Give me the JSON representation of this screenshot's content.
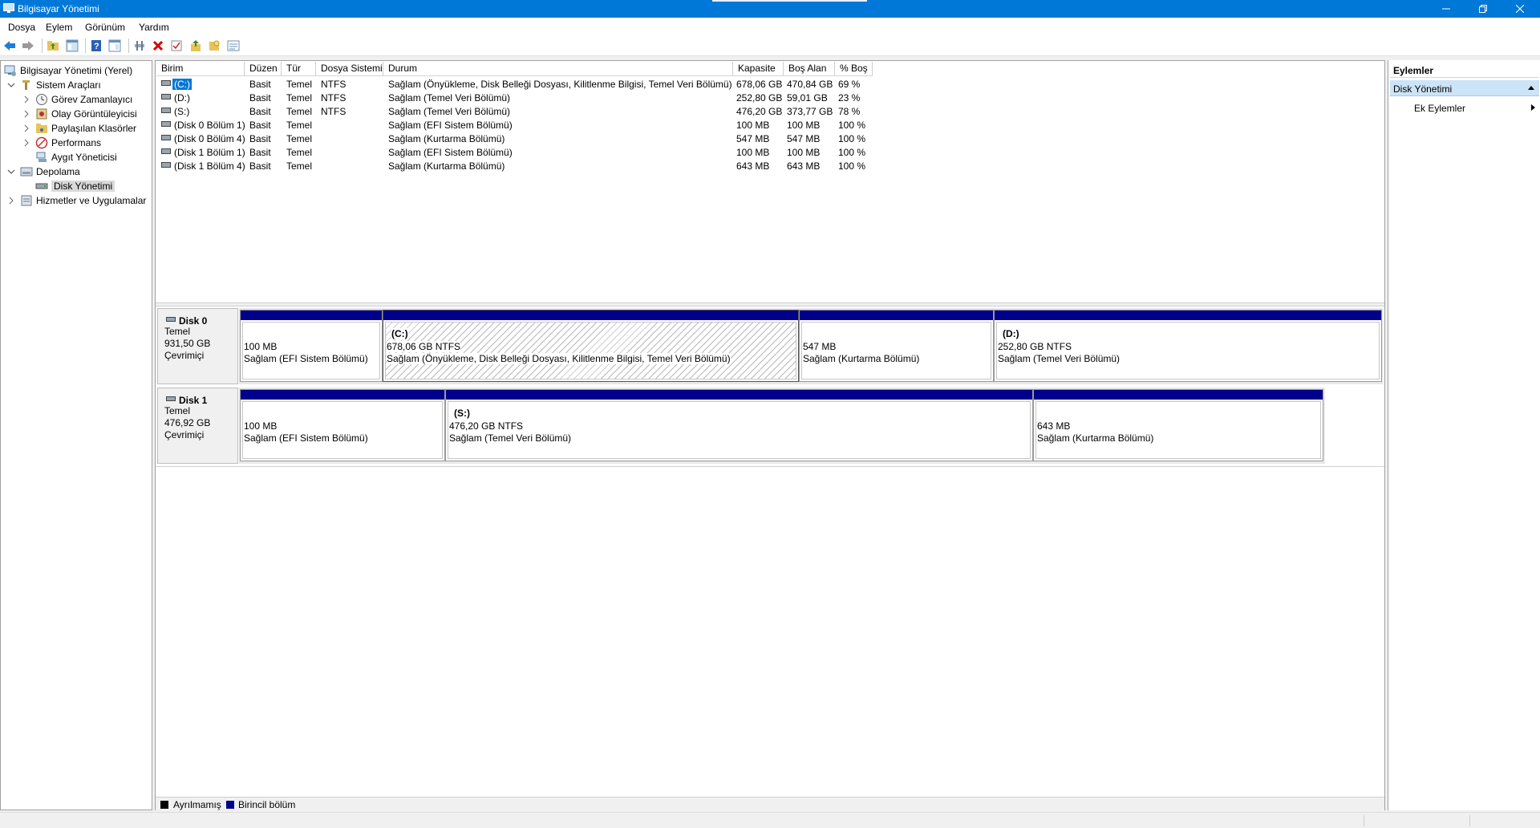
{
  "window": {
    "title": "Bilgisayar Yönetimi",
    "accent_color": "#0078d7"
  },
  "menu": [
    "Dosya",
    "Eylem",
    "Görünüm",
    "Yardım"
  ],
  "toolbar": {
    "icons": [
      "back-icon",
      "forward-icon",
      "up-folder-icon",
      "show-hide-tree-icon",
      "help-icon",
      "properties-view-icon",
      "connect-icon",
      "delete-icon",
      "check-icon",
      "export-icon",
      "new-icon",
      "list-icon"
    ]
  },
  "tree": {
    "root": "Bilgisayar Yönetimi (Yerel)",
    "system_tools": "Sistem Araçları",
    "task_scheduler": "Görev Zamanlayıcı",
    "event_viewer": "Olay Görüntüleyicisi",
    "shared_folders": "Paylaşılan Klasörler",
    "performance": "Performans",
    "device_manager": "Aygıt Yöneticisi",
    "storage": "Depolama",
    "disk_management": "Disk Yönetimi",
    "services_apps": "Hizmetler ve Uygulamalar"
  },
  "volume_list": {
    "columns": [
      "Birim",
      "Düzen",
      "Tür",
      "Dosya Sistemi",
      "Durum",
      "Kapasite",
      "Boş Alan",
      "% Boş"
    ],
    "rows": [
      {
        "name": "(C:)",
        "layout": "Basit",
        "type": "Temel",
        "fs": "NTFS",
        "status": "Sağlam (Önyükleme, Disk Belleği Dosyası, Kilitlenme Bilgisi, Temel Veri Bölümü)",
        "capacity": "678,06 GB",
        "free": "470,84 GB",
        "pct": "69 %",
        "selected": true
      },
      {
        "name": "(D:)",
        "layout": "Basit",
        "type": "Temel",
        "fs": "NTFS",
        "status": "Sağlam (Temel Veri Bölümü)",
        "capacity": "252,80 GB",
        "free": "59,01 GB",
        "pct": "23 %"
      },
      {
        "name": "(S:)",
        "layout": "Basit",
        "type": "Temel",
        "fs": "NTFS",
        "status": "Sağlam (Temel Veri Bölümü)",
        "capacity": "476,20 GB",
        "free": "373,77 GB",
        "pct": "78 %"
      },
      {
        "name": "(Disk 0 Bölüm 1)",
        "layout": "Basit",
        "type": "Temel",
        "fs": "",
        "status": "Sağlam (EFI Sistem Bölümü)",
        "capacity": "100 MB",
        "free": "100 MB",
        "pct": "100 %"
      },
      {
        "name": "(Disk 0 Bölüm 4)",
        "layout": "Basit",
        "type": "Temel",
        "fs": "",
        "status": "Sağlam (Kurtarma Bölümü)",
        "capacity": "547 MB",
        "free": "547 MB",
        "pct": "100 %"
      },
      {
        "name": "(Disk 1 Bölüm 1)",
        "layout": "Basit",
        "type": "Temel",
        "fs": "",
        "status": "Sağlam (EFI Sistem Bölümü)",
        "capacity": "100 MB",
        "free": "100 MB",
        "pct": "100 %"
      },
      {
        "name": "(Disk 1 Bölüm 4)",
        "layout": "Basit",
        "type": "Temel",
        "fs": "",
        "status": "Sağlam (Kurtarma Bölümü)",
        "capacity": "643 MB",
        "free": "643 MB",
        "pct": "100 %"
      }
    ]
  },
  "disks": [
    {
      "name": "Disk 0",
      "type": "Temel",
      "size": "931,50 GB",
      "state": "Çevrimiçi",
      "partitions": [
        {
          "title": "",
          "size": "100 MB",
          "status": "Sağlam (EFI Sistem Bölümü)"
        },
        {
          "title": "(C:)",
          "size": "678,06 GB NTFS",
          "status": "Sağlam (Önyükleme, Disk Belleği Dosyası, Kilitlenme Bilgisi, Temel Veri Bölümü)",
          "selected": true
        },
        {
          "title": "",
          "size": "547 MB",
          "status": "Sağlam (Kurtarma Bölümü)"
        },
        {
          "title": "(D:)",
          "size": "252,80 GB NTFS",
          "status": "Sağlam (Temel Veri Bölümü)"
        }
      ]
    },
    {
      "name": "Disk 1",
      "type": "Temel",
      "size": "476,92 GB",
      "state": "Çevrimiçi",
      "partitions": [
        {
          "title": "",
          "size": "100 MB",
          "status": "Sağlam (EFI Sistem Bölümü)"
        },
        {
          "title": "(S:)",
          "size": "476,20 GB NTFS",
          "status": "Sağlam (Temel Veri Bölümü)"
        },
        {
          "title": "",
          "size": "643 MB",
          "status": "Sağlam (Kurtarma Bölümü)"
        }
      ]
    }
  ],
  "legend": [
    {
      "label": "Ayrılmamış",
      "color": "#000000"
    },
    {
      "label": "Birincil bölüm",
      "color": "#00008b"
    }
  ],
  "actions": {
    "header": "Eylemler",
    "section": "Disk Yönetimi",
    "item": "Ek Eylemler"
  }
}
